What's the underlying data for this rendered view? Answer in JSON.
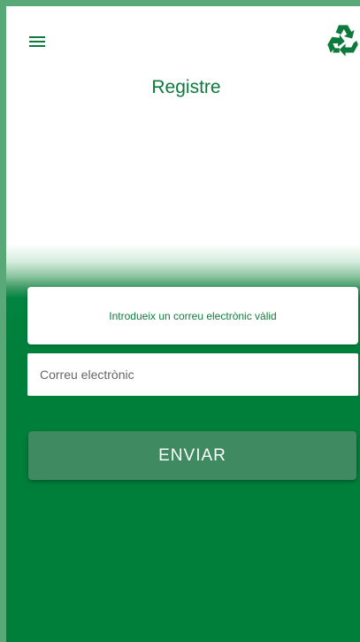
{
  "header": {
    "menu_icon": "hamburger-menu-icon",
    "logo_icon": "recycle-icon",
    "title": "Registre"
  },
  "form": {
    "notice_text": "Introdueix un correu electrònic vàlid",
    "email_placeholder": "Correu electrònic",
    "email_value": "",
    "submit_label": "ENVIAR"
  },
  "colors": {
    "brand_green": "#007f3a",
    "title_green": "#0b7a3b",
    "button_green": "#3f8a60",
    "frame_border": "#58a878"
  }
}
